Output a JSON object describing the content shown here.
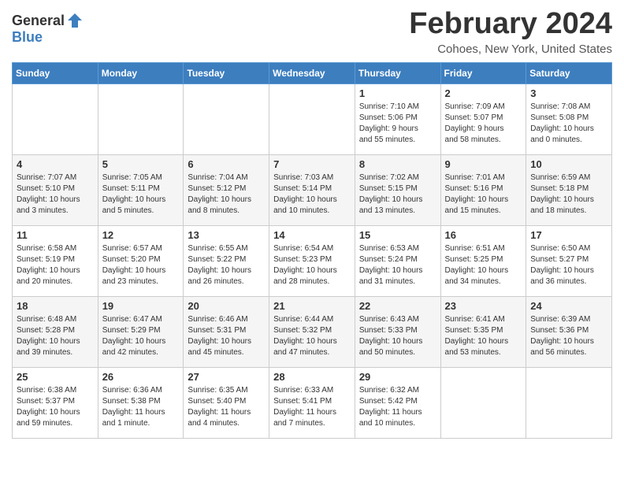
{
  "header": {
    "logo_general": "General",
    "logo_blue": "Blue",
    "month_title": "February 2024",
    "location": "Cohoes, New York, United States"
  },
  "weekdays": [
    "Sunday",
    "Monday",
    "Tuesday",
    "Wednesday",
    "Thursday",
    "Friday",
    "Saturday"
  ],
  "weeks": [
    [
      {
        "day": "",
        "info": ""
      },
      {
        "day": "",
        "info": ""
      },
      {
        "day": "",
        "info": ""
      },
      {
        "day": "",
        "info": ""
      },
      {
        "day": "1",
        "info": "Sunrise: 7:10 AM\nSunset: 5:06 PM\nDaylight: 9 hours\nand 55 minutes."
      },
      {
        "day": "2",
        "info": "Sunrise: 7:09 AM\nSunset: 5:07 PM\nDaylight: 9 hours\nand 58 minutes."
      },
      {
        "day": "3",
        "info": "Sunrise: 7:08 AM\nSunset: 5:08 PM\nDaylight: 10 hours\nand 0 minutes."
      }
    ],
    [
      {
        "day": "4",
        "info": "Sunrise: 7:07 AM\nSunset: 5:10 PM\nDaylight: 10 hours\nand 3 minutes."
      },
      {
        "day": "5",
        "info": "Sunrise: 7:05 AM\nSunset: 5:11 PM\nDaylight: 10 hours\nand 5 minutes."
      },
      {
        "day": "6",
        "info": "Sunrise: 7:04 AM\nSunset: 5:12 PM\nDaylight: 10 hours\nand 8 minutes."
      },
      {
        "day": "7",
        "info": "Sunrise: 7:03 AM\nSunset: 5:14 PM\nDaylight: 10 hours\nand 10 minutes."
      },
      {
        "day": "8",
        "info": "Sunrise: 7:02 AM\nSunset: 5:15 PM\nDaylight: 10 hours\nand 13 minutes."
      },
      {
        "day": "9",
        "info": "Sunrise: 7:01 AM\nSunset: 5:16 PM\nDaylight: 10 hours\nand 15 minutes."
      },
      {
        "day": "10",
        "info": "Sunrise: 6:59 AM\nSunset: 5:18 PM\nDaylight: 10 hours\nand 18 minutes."
      }
    ],
    [
      {
        "day": "11",
        "info": "Sunrise: 6:58 AM\nSunset: 5:19 PM\nDaylight: 10 hours\nand 20 minutes."
      },
      {
        "day": "12",
        "info": "Sunrise: 6:57 AM\nSunset: 5:20 PM\nDaylight: 10 hours\nand 23 minutes."
      },
      {
        "day": "13",
        "info": "Sunrise: 6:55 AM\nSunset: 5:22 PM\nDaylight: 10 hours\nand 26 minutes."
      },
      {
        "day": "14",
        "info": "Sunrise: 6:54 AM\nSunset: 5:23 PM\nDaylight: 10 hours\nand 28 minutes."
      },
      {
        "day": "15",
        "info": "Sunrise: 6:53 AM\nSunset: 5:24 PM\nDaylight: 10 hours\nand 31 minutes."
      },
      {
        "day": "16",
        "info": "Sunrise: 6:51 AM\nSunset: 5:25 PM\nDaylight: 10 hours\nand 34 minutes."
      },
      {
        "day": "17",
        "info": "Sunrise: 6:50 AM\nSunset: 5:27 PM\nDaylight: 10 hours\nand 36 minutes."
      }
    ],
    [
      {
        "day": "18",
        "info": "Sunrise: 6:48 AM\nSunset: 5:28 PM\nDaylight: 10 hours\nand 39 minutes."
      },
      {
        "day": "19",
        "info": "Sunrise: 6:47 AM\nSunset: 5:29 PM\nDaylight: 10 hours\nand 42 minutes."
      },
      {
        "day": "20",
        "info": "Sunrise: 6:46 AM\nSunset: 5:31 PM\nDaylight: 10 hours\nand 45 minutes."
      },
      {
        "day": "21",
        "info": "Sunrise: 6:44 AM\nSunset: 5:32 PM\nDaylight: 10 hours\nand 47 minutes."
      },
      {
        "day": "22",
        "info": "Sunrise: 6:43 AM\nSunset: 5:33 PM\nDaylight: 10 hours\nand 50 minutes."
      },
      {
        "day": "23",
        "info": "Sunrise: 6:41 AM\nSunset: 5:35 PM\nDaylight: 10 hours\nand 53 minutes."
      },
      {
        "day": "24",
        "info": "Sunrise: 6:39 AM\nSunset: 5:36 PM\nDaylight: 10 hours\nand 56 minutes."
      }
    ],
    [
      {
        "day": "25",
        "info": "Sunrise: 6:38 AM\nSunset: 5:37 PM\nDaylight: 10 hours\nand 59 minutes."
      },
      {
        "day": "26",
        "info": "Sunrise: 6:36 AM\nSunset: 5:38 PM\nDaylight: 11 hours\nand 1 minute."
      },
      {
        "day": "27",
        "info": "Sunrise: 6:35 AM\nSunset: 5:40 PM\nDaylight: 11 hours\nand 4 minutes."
      },
      {
        "day": "28",
        "info": "Sunrise: 6:33 AM\nSunset: 5:41 PM\nDaylight: 11 hours\nand 7 minutes."
      },
      {
        "day": "29",
        "info": "Sunrise: 6:32 AM\nSunset: 5:42 PM\nDaylight: 11 hours\nand 10 minutes."
      },
      {
        "day": "",
        "info": ""
      },
      {
        "day": "",
        "info": ""
      }
    ]
  ]
}
